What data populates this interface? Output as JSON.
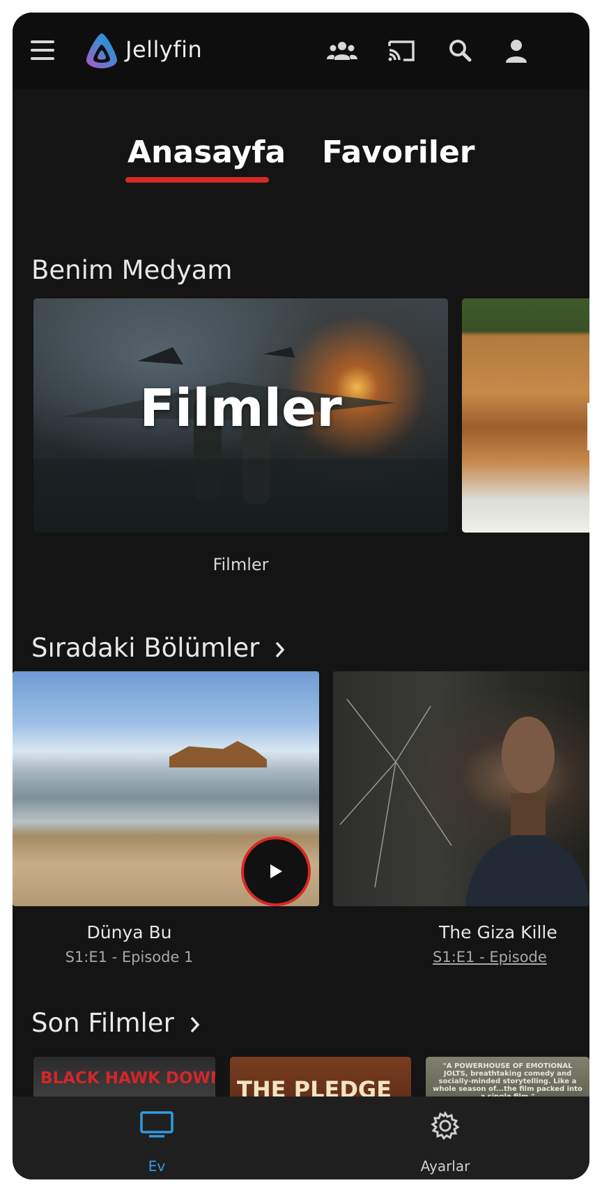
{
  "app": {
    "name": "Jellyfin"
  },
  "tabs": [
    {
      "label": "Anasayfa",
      "active": true
    },
    {
      "label": "Favoriler",
      "active": false
    }
  ],
  "sections": {
    "my_media": {
      "title": "Benim Medyam",
      "cards": [
        {
          "overlay_title": "Filmler",
          "caption": "Filmler"
        }
      ]
    },
    "next_up": {
      "title": "Sıradaki Bölümler",
      "episodes": [
        {
          "title": "Dünya Bu",
          "subtitle": "S1:E1 - Episode 1"
        },
        {
          "title": "The Giza Kille",
          "subtitle": "S1:E1 - Episode"
        }
      ]
    },
    "recent_movies": {
      "title": "Son Filmler",
      "posters": [
        {
          "text": "BLACK HAWK DOWN"
        },
        {
          "text": "THE PLEDGE"
        },
        {
          "text": "\"A POWERHOUSE OF EMOTIONAL JOLTS, breathtaking comedy and socially-minded storytelling. Like a whole season of...the film packed into a single film.\""
        }
      ]
    }
  },
  "bottom_nav": [
    {
      "label": "Ev",
      "icon": "tv-icon",
      "active": true
    },
    {
      "label": "Ayarlar",
      "icon": "gear-icon",
      "active": false
    }
  ],
  "colors": {
    "accent_red": "#d52a25",
    "active_blue": "#2f9be0",
    "background": "#141414"
  }
}
